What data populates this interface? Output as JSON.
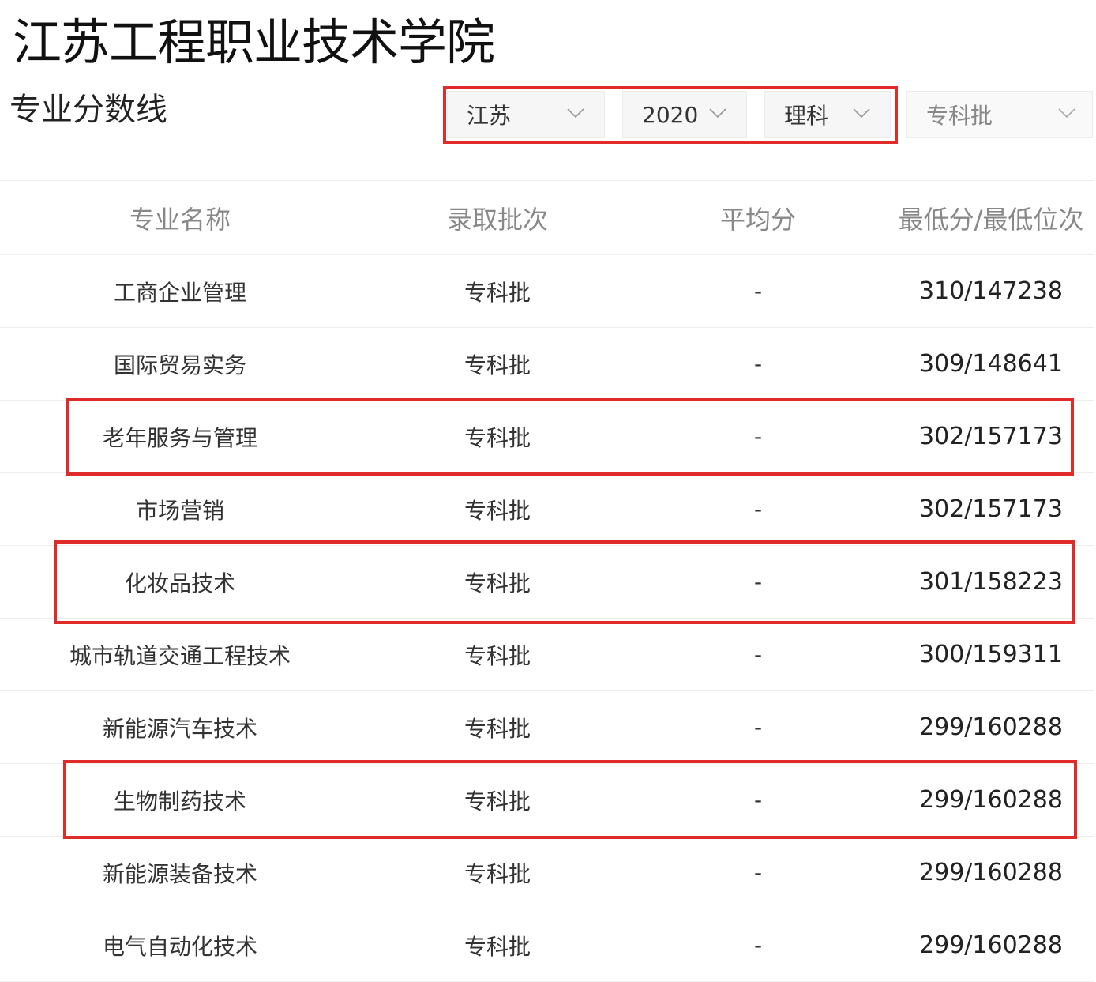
{
  "header": {
    "school_name": "江苏工程职业技术学院",
    "section_title": "专业分数线"
  },
  "filters": {
    "province": "江苏",
    "year": "2020",
    "subject": "理科",
    "batch": "专科批"
  },
  "table": {
    "headers": [
      "专业名称",
      "录取批次",
      "平均分",
      "最低分/最低位次"
    ],
    "rows": [
      {
        "major": "工商企业管理",
        "batch": "专科批",
        "avg": "-",
        "min_rank": "310/147238"
      },
      {
        "major": "国际贸易实务",
        "batch": "专科批",
        "avg": "-",
        "min_rank": "309/148641"
      },
      {
        "major": "老年服务与管理",
        "batch": "专科批",
        "avg": "-",
        "min_rank": "302/157173"
      },
      {
        "major": "市场营销",
        "batch": "专科批",
        "avg": "-",
        "min_rank": "302/157173"
      },
      {
        "major": "化妆品技术",
        "batch": "专科批",
        "avg": "-",
        "min_rank": "301/158223"
      },
      {
        "major": "城市轨道交通工程技术",
        "batch": "专科批",
        "avg": "-",
        "min_rank": "300/159311"
      },
      {
        "major": "新能源汽车技术",
        "batch": "专科批",
        "avg": "-",
        "min_rank": "299/160288"
      },
      {
        "major": "生物制药技术",
        "batch": "专科批",
        "avg": "-",
        "min_rank": "299/160288"
      },
      {
        "major": "新能源装备技术",
        "batch": "专科批",
        "avg": "-",
        "min_rank": "299/160288"
      },
      {
        "major": "电气自动化技术",
        "batch": "专科批",
        "avg": "-",
        "min_rank": "299/160288"
      }
    ]
  },
  "colors": {
    "highlight": "#e02b2b",
    "header_text": "#888888",
    "body_text": "#333333"
  }
}
